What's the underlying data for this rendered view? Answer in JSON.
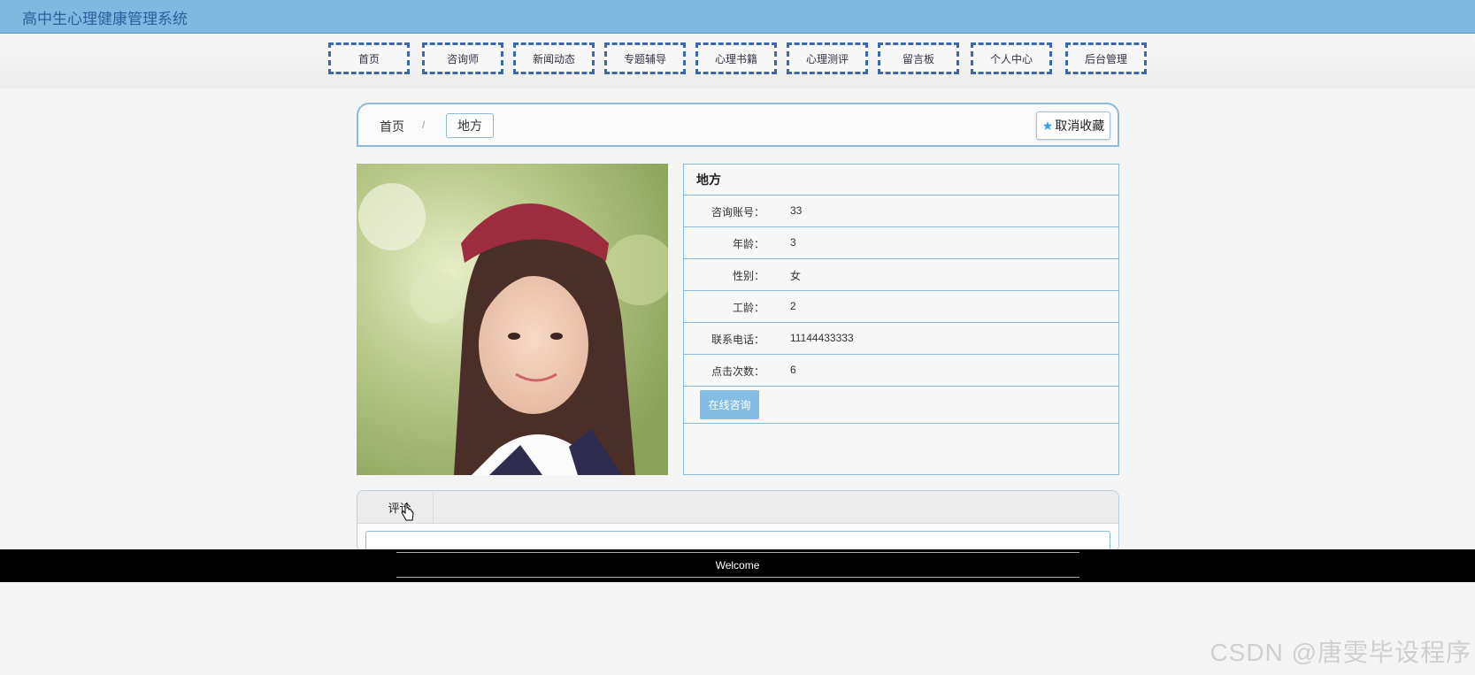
{
  "app": {
    "title": "高中生心理健康管理系统"
  },
  "nav": {
    "items": [
      "首页",
      "咨询师",
      "新闻动态",
      "专题辅导",
      "心理书籍",
      "心理测评",
      "留言板",
      "个人中心",
      "后台管理"
    ]
  },
  "breadcrumb": {
    "home": "首页",
    "separator": "/",
    "current": "地方"
  },
  "favorite": {
    "label": "取消收藏",
    "icon": "star-icon"
  },
  "detail": {
    "name": "地方",
    "fields": [
      {
        "label": "咨询账号：",
        "value": "33"
      },
      {
        "label": "年龄：",
        "value": "3"
      },
      {
        "label": "性别：",
        "value": "女"
      },
      {
        "label": "工龄：",
        "value": "2"
      },
      {
        "label": "联系电话：",
        "value": "11144433333"
      },
      {
        "label": "点击次数：",
        "value": "6"
      }
    ],
    "consult_button": "在线咨询"
  },
  "comments": {
    "tab_label": "评论"
  },
  "footer": {
    "text": "Welcome"
  },
  "watermark": "CSDN @唐雯毕设程序",
  "colors": {
    "topbar": "#7fb8e0",
    "nav_border": "#3f66a8",
    "accent": "#84bde3"
  }
}
